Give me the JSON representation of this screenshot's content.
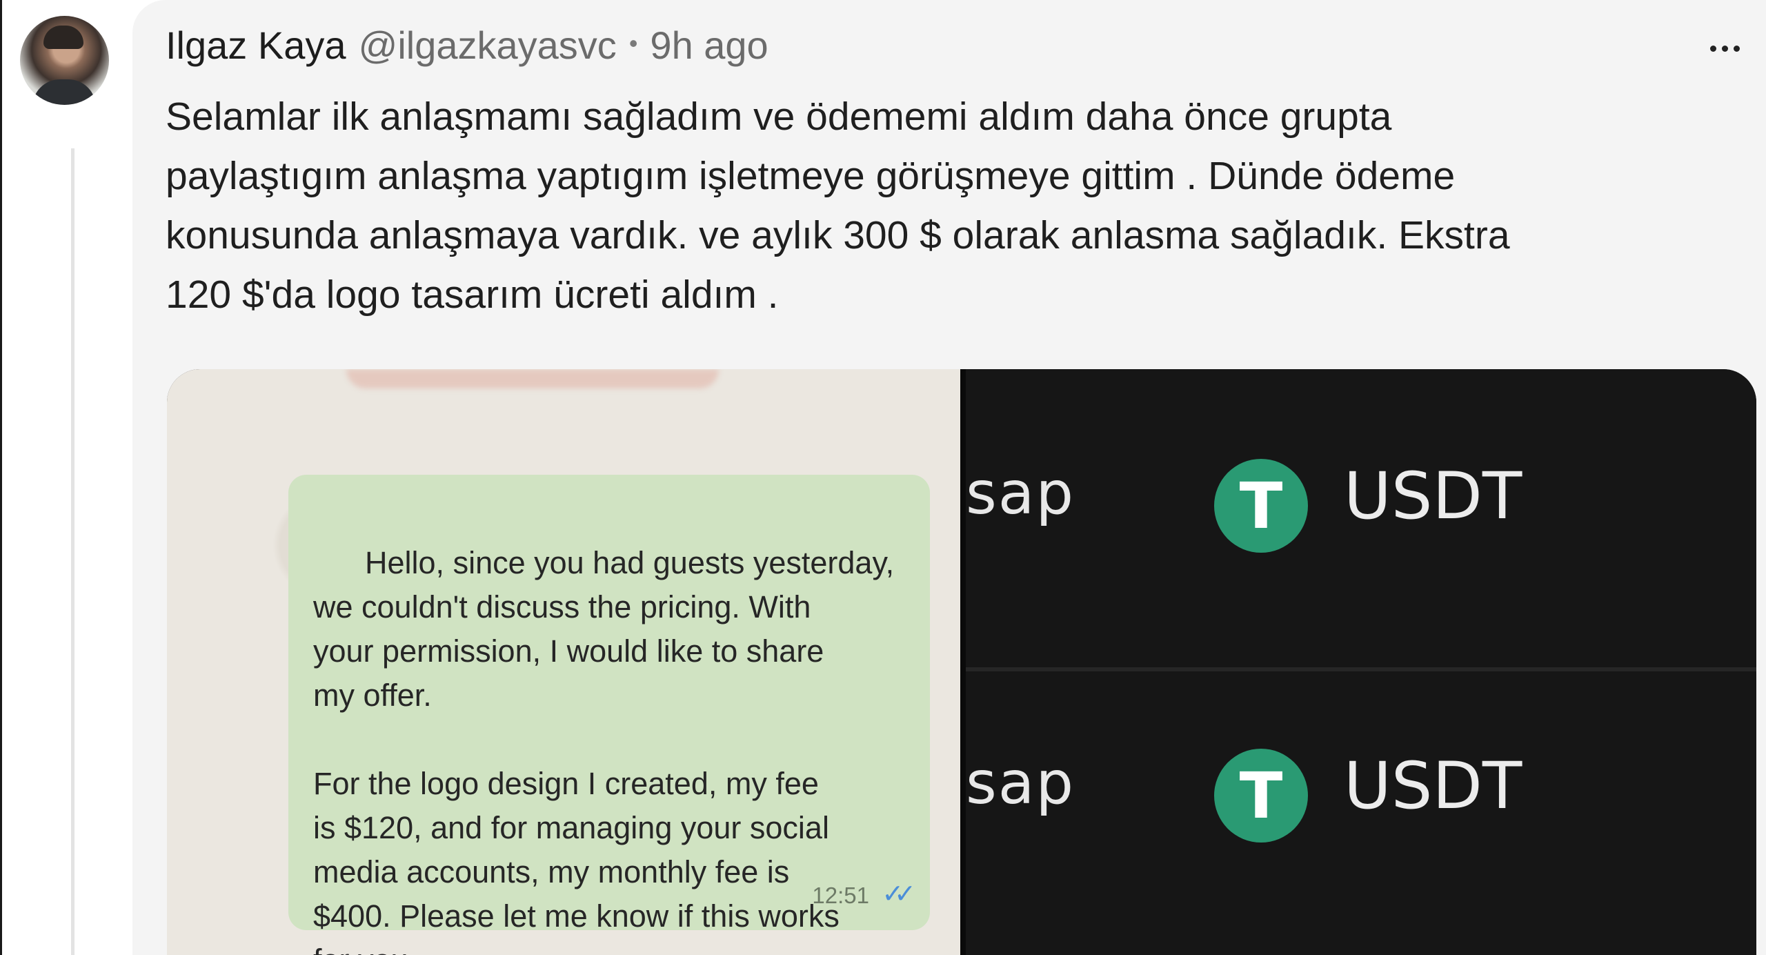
{
  "post": {
    "author": "Ilgaz Kaya",
    "handle": "@ilgazkayasvc",
    "separator": "•",
    "time": "9h ago",
    "text": "Selamlar ilk anlaşmamı sağladım ve ödememi aldım daha önce grupta\npaylaştıgım anlaşma yaptıgım işletmeye görüşmeye gittim . Dünde ödeme\nkonusunda anlaşmaya vardık. ve aylık 300 $ olarak anlasma sağladık. Ekstra\n120 $'da logo tasarım ücreti aldım ."
  },
  "menu": {
    "icon": "more-horizontal-icon"
  },
  "chat_image": {
    "message": "Hello, since you had guests yesterday,\nwe couldn't discuss the pricing. With\nyour permission, I would like to share\nmy offer.\n\nFor the logo design I created, my fee\nis $120, and for managing your social\nmedia accounts, my monthly fee is\n$400. Please let me know if this works\nfor you.",
    "time": "12:51",
    "read_icon": "double-check-icon"
  },
  "wallet_image": {
    "rows": [
      {
        "fragment": "sap",
        "token_glyph": "T",
        "token": "USDT"
      },
      {
        "fragment": "sap",
        "token_glyph": "T",
        "token": "USDT"
      }
    ]
  },
  "colors": {
    "card_bg": "#f4f4f4",
    "bubble_bg": "#d0e3c2",
    "tether_green": "#2a9a73",
    "wallet_bg": "#161616"
  }
}
